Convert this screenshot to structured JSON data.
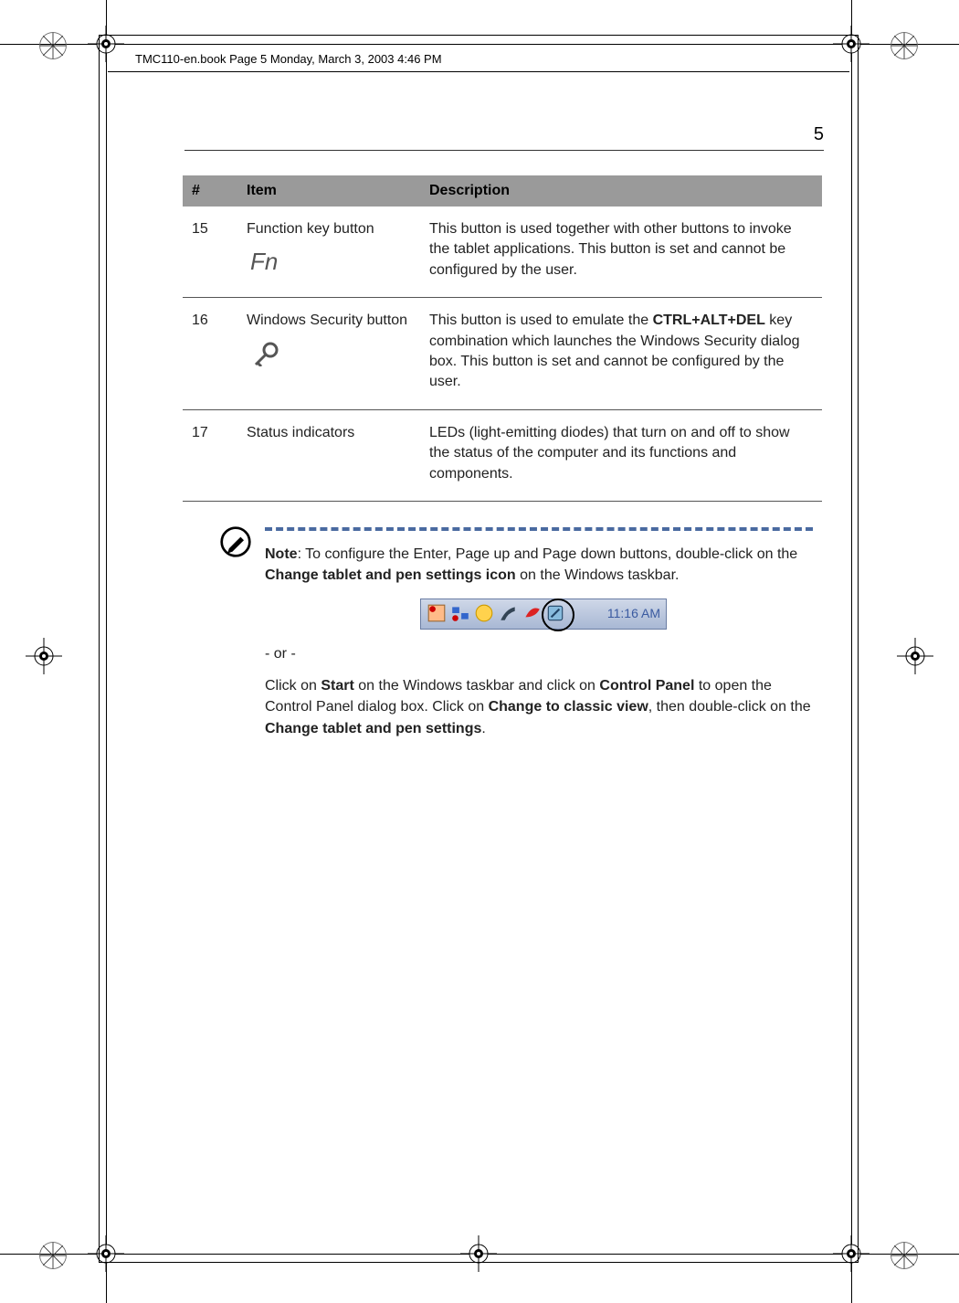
{
  "header": {
    "label": "TMC110-en.book  Page 5  Monday, March 3, 2003  4:46 PM"
  },
  "page_number": "5",
  "table": {
    "headers": {
      "num": "#",
      "item": "Item",
      "desc": "Description"
    },
    "rows": [
      {
        "num": "15",
        "item": "Function key button",
        "glyph": "Fn",
        "desc": "This button is used together with other buttons to invoke the tablet applications.  This button is set and cannot be configured by the user."
      },
      {
        "num": "16",
        "item": "Windows Security button",
        "desc_pre": "This button is used to emulate the ",
        "desc_bold": "CTRL+ALT+DEL",
        "desc_post": " key combination which launches the Windows Security dialog box. This button is set and cannot be configured by the user."
      },
      {
        "num": "17",
        "item": "Status indicators",
        "desc": "LEDs (light-emitting diodes) that turn on and off to show the status of the computer and its functions and components."
      }
    ]
  },
  "note": {
    "label": "Note",
    "text_pre": ": To configure the Enter, Page up and Page down buttons, double-click on the ",
    "bold1": "Change tablet and pen settings icon",
    "text_post": " on the Windows taskbar."
  },
  "taskbar": {
    "time": "11:16 AM"
  },
  "or_sep": "- or -",
  "para2": {
    "t1": "Click on ",
    "b1": "Start",
    "t2": " on the Windows taskbar and click on ",
    "b2": "Control Panel",
    "t3": " to open the Control Panel dialog box. Click on ",
    "b3": "Change to classic view",
    "t4": ", then double-click on the ",
    "b4": "Change tablet and pen settings",
    "t5": "."
  }
}
